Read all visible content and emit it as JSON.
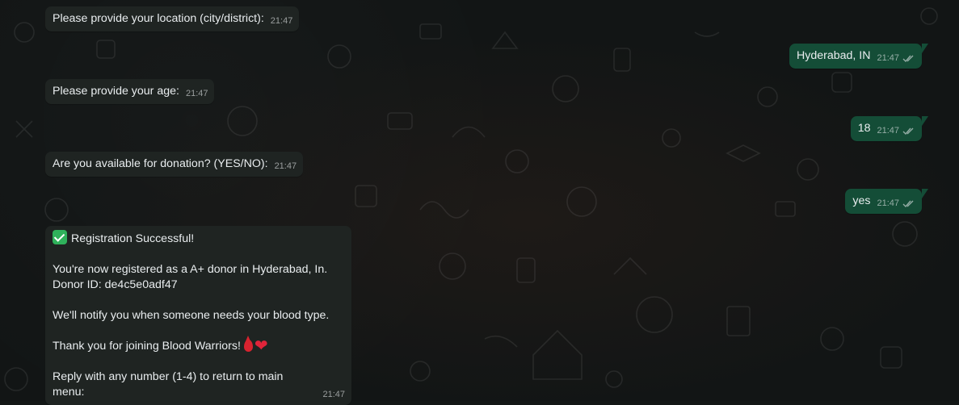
{
  "messages": [
    {
      "id": "m1",
      "direction": "in",
      "text": "Please provide your location (city/district):",
      "time": "21:47"
    },
    {
      "id": "m2",
      "direction": "out",
      "text": "Hyderabad, IN",
      "time": "21:47",
      "status": "read"
    },
    {
      "id": "m3",
      "direction": "in",
      "text": "Please provide your age:",
      "time": "21:47"
    },
    {
      "id": "m4",
      "direction": "out",
      "text": "18",
      "time": "21:47",
      "status": "read"
    },
    {
      "id": "m5",
      "direction": "in",
      "text": "Are you available for donation? (YES/NO):",
      "time": "21:47"
    },
    {
      "id": "m6",
      "direction": "out",
      "text": "yes",
      "time": "21:47",
      "status": "read"
    }
  ],
  "registration": {
    "title": "Registration Successful!",
    "registered_line": "You're now registered as a A+ donor in Hyderabad, In.",
    "donor_id_line": "Donor ID: de4c5e0adf47",
    "notify_line": "We'll notify you when someone needs your blood type.",
    "thanks_line": "Thank you for joining Blood Warriors!",
    "reply_line": "Reply with any number (1-4) to return to main menu:",
    "time": "21:47",
    "icons": [
      "check-mark-emoji",
      "blood-drop-emoji",
      "red-heart-emoji"
    ]
  },
  "colors": {
    "background": "#121515",
    "incoming_bubble": "#1f2422",
    "outgoing_bubble": "#144d37",
    "text": "#e9edef"
  }
}
